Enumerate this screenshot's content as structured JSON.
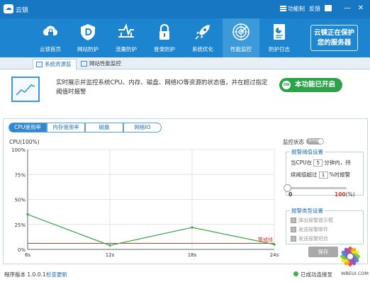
{
  "window": {
    "app_title": "云锁",
    "menu_label": "功能制",
    "feedback_label": "反馈",
    "minimize": "—",
    "close": "✕"
  },
  "nav": {
    "items": [
      {
        "label": "云锁首页",
        "icon": "cloud-lock-icon"
      },
      {
        "label": "网站防护",
        "icon": "shield-d-icon"
      },
      {
        "label": "流量防护",
        "icon": "traffic-icon"
      },
      {
        "label": "登录防护",
        "icon": "padlock-icon"
      },
      {
        "label": "系统优化",
        "icon": "rocket-icon"
      },
      {
        "label": "性能监控",
        "icon": "radar-icon"
      },
      {
        "label": "防护日志",
        "icon": "log-book-icon"
      }
    ],
    "active_index": 5,
    "promo_line1": "云镜正在保护",
    "promo_line2": "您的服务器"
  },
  "subtabs": {
    "items": [
      "系统资源监控",
      "网站性能监控"
    ],
    "active_index": 0
  },
  "info": {
    "description": "实时展示并监控系统CPU、内存、磁盘、网络IO等资源的状态值，并在超过指定阈值时报警",
    "enabled_label": "本功能已开启",
    "enabled_icon_text": "ON"
  },
  "monitor_tabs": {
    "items": [
      "CPU使用率",
      "内存使用率",
      "磁盘",
      "网络IO"
    ],
    "active_index": 0
  },
  "chart_data": {
    "type": "line",
    "title": "CPU(100%)",
    "x": [
      "6s",
      "12s",
      "18s",
      "24s"
    ],
    "series": [
      {
        "values": [
          35,
          4,
          22,
          5
        ],
        "color": "#3aa64a"
      }
    ],
    "threshold": {
      "label": "警戒线",
      "value": 6,
      "color": "#d33a2c"
    },
    "y_ticks": [
      "0%",
      "25%",
      "50%",
      "75%",
      "100%"
    ],
    "ylim": [
      0,
      100
    ],
    "grid": true
  },
  "side": {
    "status_label": "监控状态",
    "status_toggle_text": "未开启",
    "threshold_group_title": "报警阈值设置",
    "cpu_line_prefix": "当CPU在",
    "cpu_minutes": "5",
    "cpu_line_suffix": "分钟内，持",
    "continuous_prefix": "续阈值超过",
    "continuous_value": "1",
    "continuous_suffix": "%时报警",
    "slider_min": "0",
    "slider_max": "100",
    "slider_unit": "(%)",
    "slider_level": 0,
    "type_group_title": "报警类型设置",
    "types": [
      "弹出报警提示框",
      "发送报警邮件",
      "发送报警短信"
    ],
    "save_label": "保存"
  },
  "status": {
    "version": "程序版本 1.0.0.1",
    "check_update": "检查更新",
    "connection": "已成功连接至"
  },
  "watermark": {
    "text": "WBEUI.COM"
  }
}
